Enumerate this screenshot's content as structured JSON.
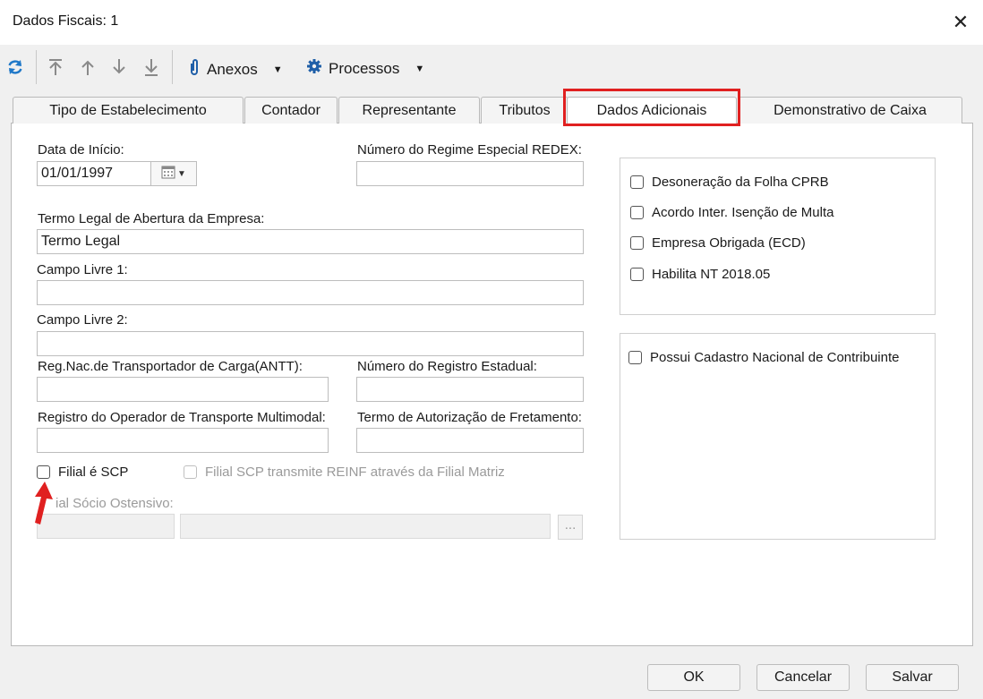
{
  "window": {
    "title": "Dados Fiscais: 1",
    "close_glyph": "✕"
  },
  "toolbar": {
    "refresh_icon": "refresh-icon",
    "nav_icons": [
      "first-record-icon",
      "previous-record-icon",
      "next-record-icon",
      "last-record-icon"
    ],
    "anexos_label": "Anexos",
    "processos_label": "Processos"
  },
  "tabs": [
    {
      "label": "Tipo de Estabelecimento"
    },
    {
      "label": "Contador"
    },
    {
      "label": "Representante"
    },
    {
      "label": "Tributos"
    },
    {
      "label": "Dados Adicionais",
      "active": true
    },
    {
      "label": "Demonstrativo de Caixa"
    }
  ],
  "form": {
    "data_inicio": {
      "label": "Data de Início:",
      "value": "01/01/1997"
    },
    "redex": {
      "label": "Número do Regime Especial REDEX:",
      "value": ""
    },
    "termo_legal": {
      "label": "Termo Legal de Abertura da Empresa:",
      "value": "Termo Legal"
    },
    "campo_livre_1": {
      "label": "Campo Livre 1:",
      "value": ""
    },
    "campo_livre_2": {
      "label": "Campo Livre 2:",
      "value": ""
    },
    "antt": {
      "label": "Reg.Nac.de Transportador de Carga(ANTT):",
      "value": ""
    },
    "registro_estadual": {
      "label": "Número do Registro Estadual:",
      "value": ""
    },
    "operador_multimodal": {
      "label": "Registro do Operador de Transporte Multimodal:",
      "value": ""
    },
    "fretamento": {
      "label": "Termo de Autorização de Fretamento:",
      "value": ""
    },
    "filial_scp": {
      "label": "Filial é SCP"
    },
    "filial_scp_reinf": {
      "label": "Filial SCP transmite REINF através da Filial Matriz"
    },
    "socio_ostensivo": {
      "label": "ial Sócio Ostensivo:",
      "ellipsis": "..."
    }
  },
  "right_checks": [
    {
      "label": "Desoneração da Folha CPRB"
    },
    {
      "label": "Acordo Inter. Isenção de Multa"
    },
    {
      "label": "Empresa Obrigada (ECD)"
    },
    {
      "label": "Habilita NT 2018.05"
    }
  ],
  "cnc_check": {
    "label": "Possui Cadastro Nacional de Contribuinte"
  },
  "buttons": {
    "ok": "OK",
    "cancel": "Cancelar",
    "save": "Salvar"
  },
  "colors": {
    "highlight": "#e02020",
    "pointer_arrow": "#e02020",
    "refresh_icon": "#1f78c8",
    "gear_icon": "#1f5fa8"
  }
}
